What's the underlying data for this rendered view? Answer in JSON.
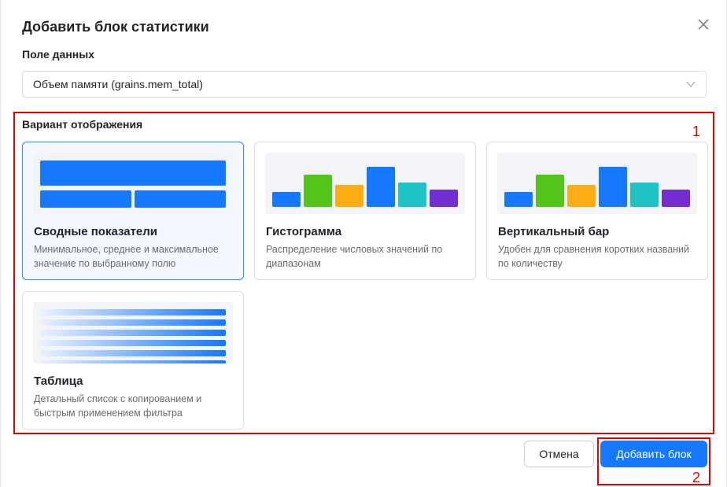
{
  "dialog": {
    "title": "Добавить блок статистики"
  },
  "data_field": {
    "label": "Поле данных",
    "value": "Объем памяти (grains.mem_total)"
  },
  "display": {
    "label": "Вариант отображения",
    "cards": [
      {
        "title": "Сводные показатели",
        "description": "Минимальное, среднее и максимальное значение по выбранному полю",
        "selected": true
      },
      {
        "title": "Гистограмма",
        "description": "Распределение числовых значений по диапазонам",
        "selected": false
      },
      {
        "title": "Вертикальный бар",
        "description": "Удобен для сравнения коротких названий по количеству",
        "selected": false
      },
      {
        "title": "Таблица",
        "description": "Детальный список с копированием и быстрым применением фильтра",
        "selected": false
      }
    ]
  },
  "footer": {
    "cancel_label": "Отмена",
    "add_label": "Добавить блок"
  },
  "annotations": {
    "box1": "1",
    "box2": "2"
  },
  "colors": {
    "primary": "#1677ff",
    "selected_border": "#3d8ff0",
    "annotation": "#e60000",
    "bar_blue": "#1677ff",
    "bar_green": "#52c41a",
    "bar_orange": "#faad14",
    "bar_teal": "#20c3c3",
    "bar_purple": "#722ed1"
  },
  "icons": {
    "close": "close-icon",
    "dropdown": "chevron-down-icon"
  }
}
